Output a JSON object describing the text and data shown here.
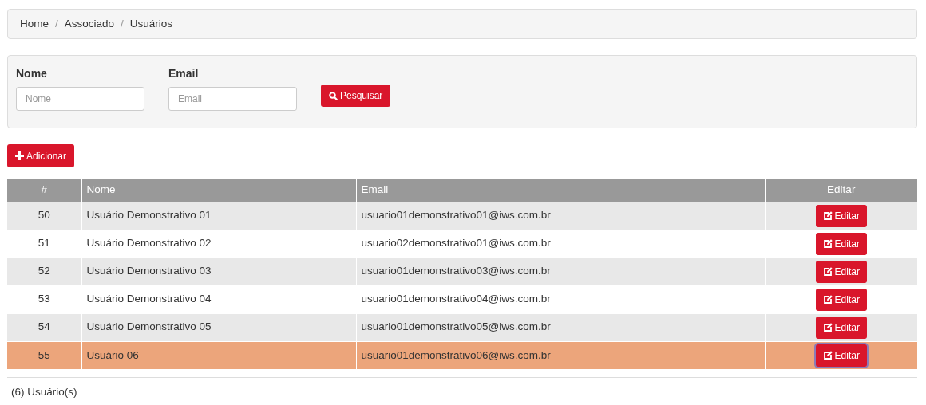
{
  "breadcrumb": [
    "Home",
    "Associado",
    "Usuários"
  ],
  "breadcrumb_separator": "/",
  "filters": [
    {
      "label": "Nome",
      "placeholder": "Nome"
    },
    {
      "label": "Email",
      "placeholder": "Email"
    }
  ],
  "search_button": "Pesquisar",
  "add_button": "Adicionar",
  "table": {
    "columns": [
      "#",
      "Nome",
      "Email",
      "Editar"
    ],
    "rows": [
      {
        "id": "50",
        "name": "Usuário Demonstrativo 01",
        "email": "usuario01demonstrativo01@iws.com.br",
        "action": "Editar",
        "selected": false
      },
      {
        "id": "51",
        "name": "Usuário Demonstrativo 02",
        "email": "usuario02demonstrativo01@iws.com.br",
        "action": "Editar",
        "selected": false
      },
      {
        "id": "52",
        "name": "Usuário Demonstrativo 03",
        "email": "usuario01demonstrativo03@iws.com.br",
        "action": "Editar",
        "selected": false
      },
      {
        "id": "53",
        "name": "Usuário Demonstrativo 04",
        "email": "usuario01demonstrativo04@iws.com.br",
        "action": "Editar",
        "selected": false
      },
      {
        "id": "54",
        "name": "Usuário Demonstrativo 05",
        "email": "usuario01demonstrativo05@iws.com.br",
        "action": "Editar",
        "selected": false
      },
      {
        "id": "55",
        "name": "Usuário 06",
        "email": "usuario01demonstrativo06@iws.com.br",
        "action": "Editar",
        "selected": true
      }
    ]
  },
  "footer": "(6) Usuário(s)"
}
